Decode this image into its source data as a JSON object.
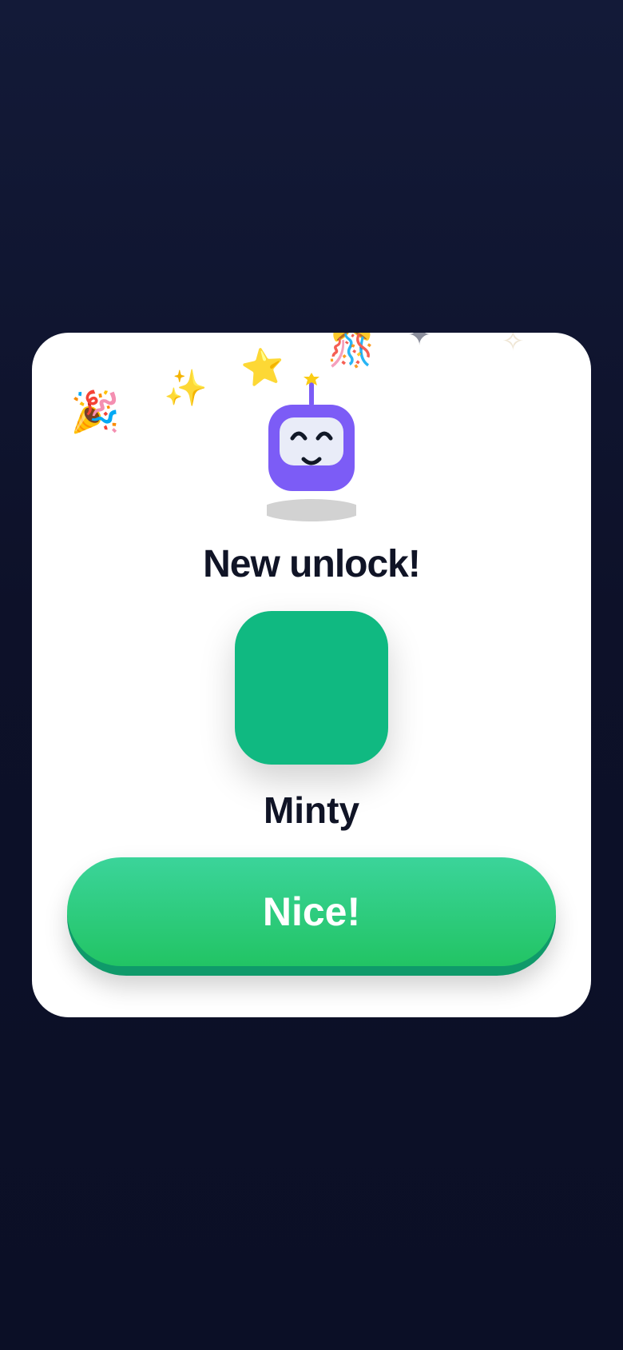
{
  "dialog": {
    "title": "New unlock!",
    "item_name": "Minty",
    "item_color": "#10b981",
    "button_label": "Nice!",
    "button_color": "#22c55e"
  },
  "decor": {
    "confetti": [
      "party-popper-icon",
      "sparkles-icon",
      "star-icon",
      "confetti-ball-icon",
      "sparkle-icon"
    ],
    "mascot": "robot-mascot-icon",
    "mascot_color": "#7c5cf6"
  }
}
